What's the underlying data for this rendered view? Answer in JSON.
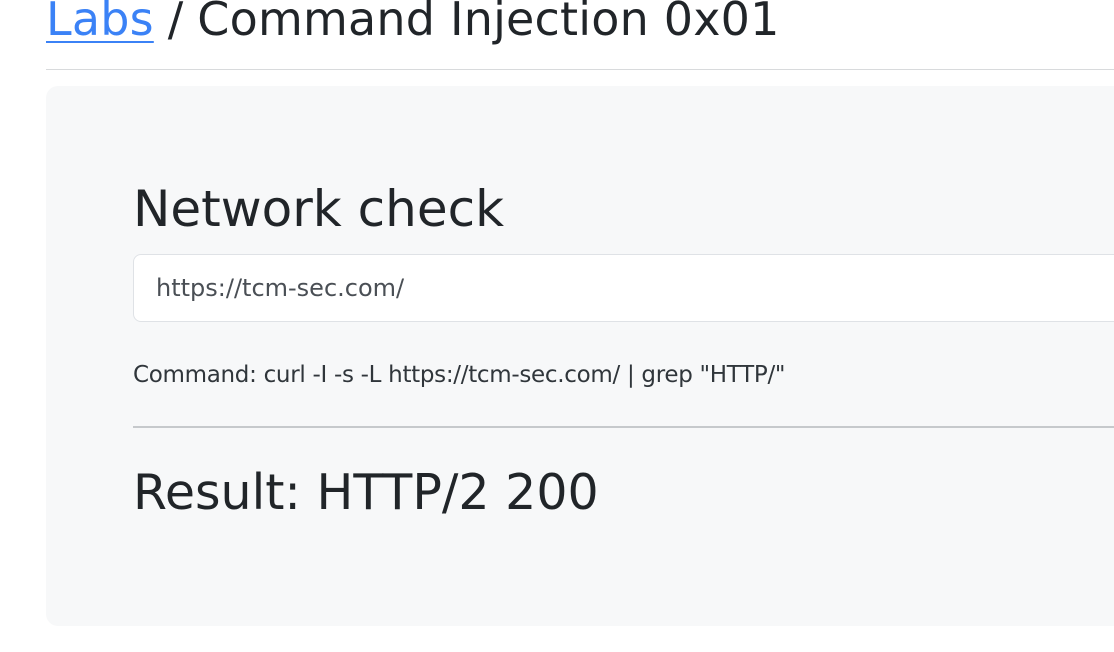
{
  "breadcrumb": {
    "link_label": "Labs",
    "separator": "/",
    "title": "Command Injection 0x01"
  },
  "form": {
    "heading": "Network check",
    "url_value": "https://tcm-sec.com/"
  },
  "output": {
    "command_text": "Command: curl -I -s -L https://tcm-sec.com/ | grep \"HTTP/\"",
    "result_text": "Result: HTTP/2 200"
  },
  "colors": {
    "link": "#3b82f6",
    "card_background": "#f7f8f9",
    "text": "#212529"
  }
}
